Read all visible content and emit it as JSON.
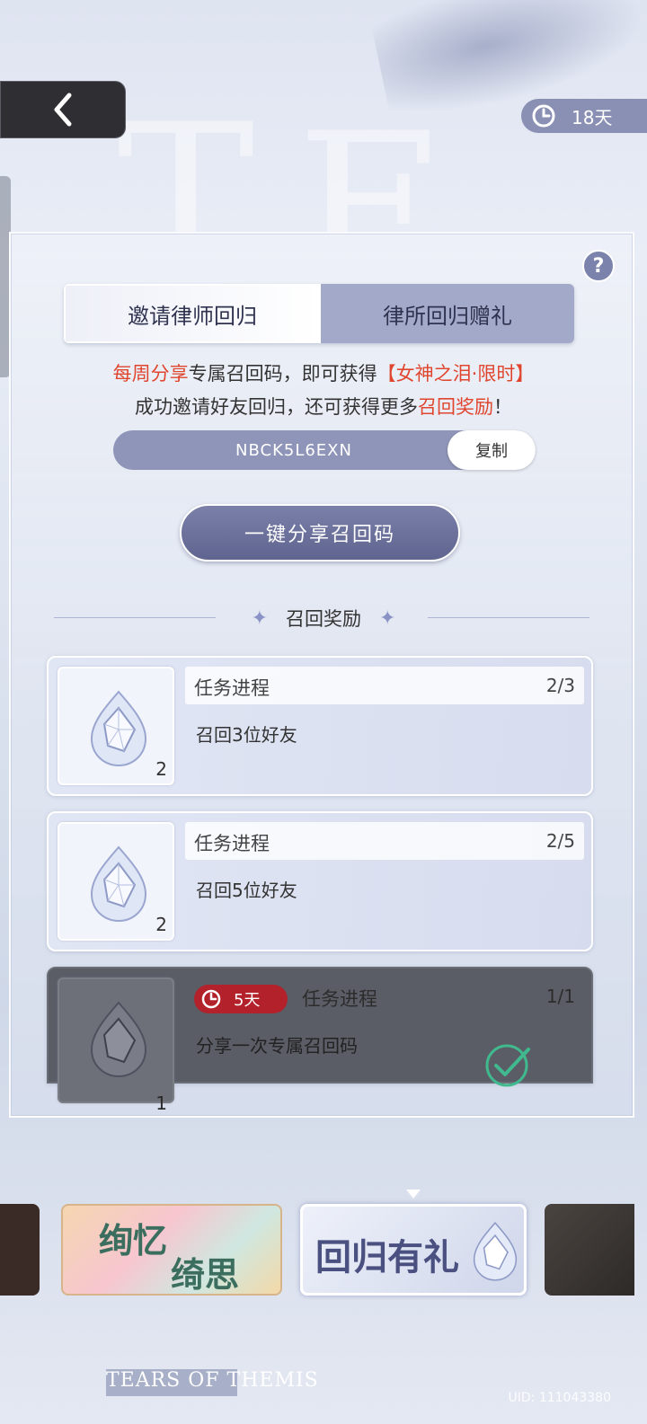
{
  "header": {
    "timer_days": "18天"
  },
  "tabs": [
    {
      "label": "邀请律师回归",
      "active": true
    },
    {
      "label": "律所回归赠礼",
      "active": false
    }
  ],
  "help_label": "?",
  "description": {
    "line1_red1": "每周分享",
    "line1_text": "专属召回码，即可获得",
    "line1_red2": "【女神之泪·限时】",
    "line2_text": "成功邀请好友回归，还可获得更多",
    "line2_red": "召回奖励",
    "line2_end": "！"
  },
  "recall_code": {
    "code": "NBCK5L6EXN",
    "copy_label": "复制"
  },
  "share_button": "一键分享召回码",
  "section_title": "召回奖励",
  "rewards": [
    {
      "progress_label": "任务进程",
      "progress": "2/3",
      "task": "召回3位好友",
      "item_count": "2",
      "completed": false
    },
    {
      "progress_label": "任务进程",
      "progress": "2/5",
      "task": "召回5位好友",
      "item_count": "2",
      "completed": false
    },
    {
      "progress_label": "任务进程",
      "progress": "1/1",
      "task": "分享一次专属召回码",
      "item_count": "1",
      "completed": true,
      "timer": "5天"
    }
  ],
  "banners": [
    {
      "line1": "绚忆",
      "line2": "绮思"
    },
    {
      "text": "回归有礼"
    }
  ],
  "brand": "TEARS OF THEMIS",
  "uid": "UID: 111043380",
  "colors": {
    "accent_red": "#e0452e",
    "button_purple": "#6a7099",
    "timer_red": "#b3212a",
    "check_green": "#3fb98d"
  }
}
